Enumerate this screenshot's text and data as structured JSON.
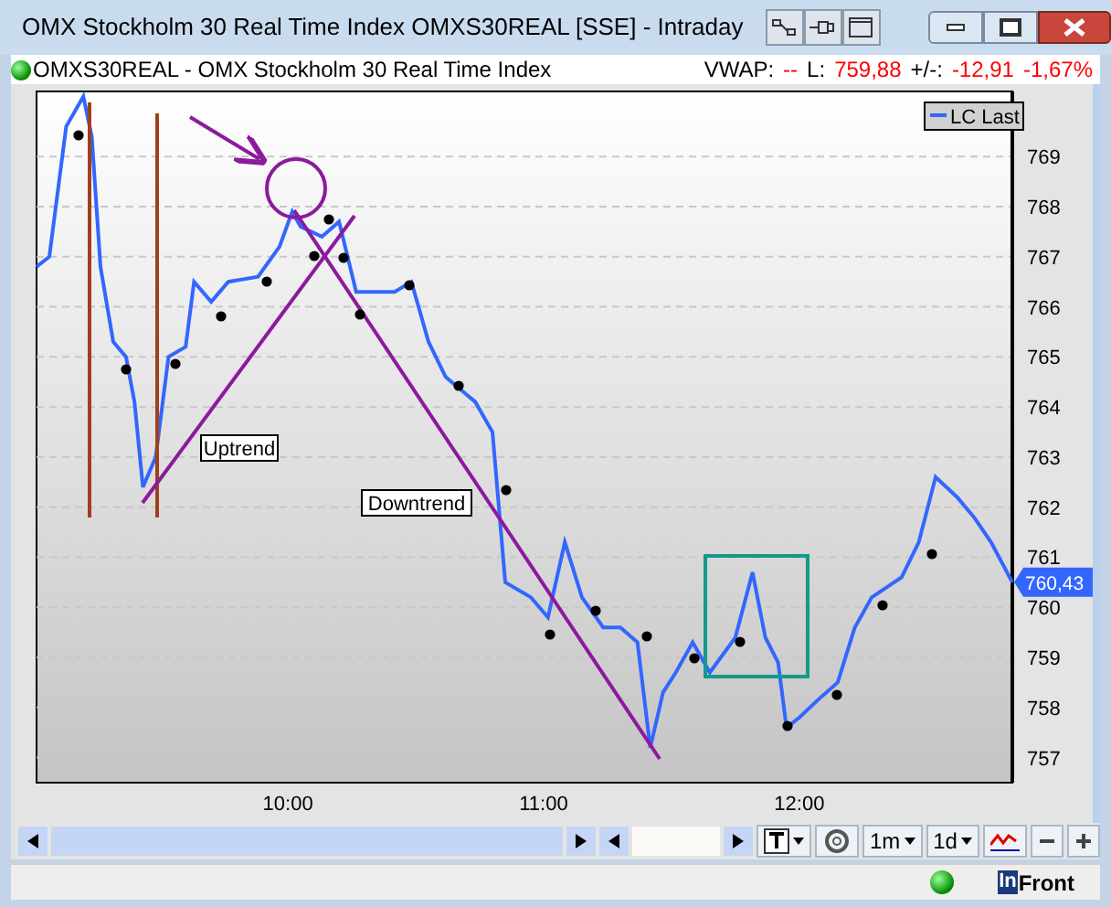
{
  "window": {
    "title": "OMX Stockholm 30 Real Time Index OMXS30REAL [SSE] - Intraday"
  },
  "info_bar": {
    "instrument": "OMXS30REAL - OMX Stockholm 30 Real Time Index",
    "quote_items": [
      {
        "label": "VWAP:",
        "values": [
          "--"
        ]
      },
      {
        "label": "L:",
        "values": [
          "759,88"
        ]
      },
      {
        "label": "+/-:",
        "values": [
          "-12,91",
          "-1,67%"
        ]
      }
    ]
  },
  "chart": {
    "last_price_label": "760,43",
    "chart_data": {
      "type": "line",
      "grid": true,
      "xlim": [
        9.017,
        12.833
      ],
      "ylim": [
        756.5,
        770.3
      ],
      "xticks": [
        {
          "value": 10,
          "label": "10:00"
        },
        {
          "value": 11,
          "label": "11:00"
        },
        {
          "value": 12,
          "label": "12:00"
        }
      ],
      "yticks": [
        757,
        758,
        759,
        760,
        761,
        762,
        763,
        764,
        765,
        766,
        767,
        768,
        769
      ],
      "x": [
        9.017,
        9.067,
        9.1,
        9.133,
        9.2,
        9.233,
        9.267,
        9.317,
        9.367,
        9.4,
        9.433,
        9.483,
        9.533,
        9.6,
        9.633,
        9.7,
        9.767,
        9.883,
        9.967,
        10.017,
        10.05,
        10.133,
        10.2,
        10.267,
        10.333,
        10.417,
        10.483,
        10.55,
        10.617,
        10.733,
        10.8,
        10.85,
        10.95,
        11.017,
        11.083,
        11.15,
        11.233,
        11.3,
        11.367,
        11.417,
        11.467,
        11.517,
        11.583,
        11.65,
        11.75,
        11.817,
        11.867,
        11.917,
        11.95,
        12,
        12.083,
        12.15,
        12.217,
        12.283,
        12.4,
        12.467,
        12.533,
        12.617,
        12.683,
        12.75,
        12.833
      ],
      "series": [
        {
          "name": "LC Last",
          "color": "#3366ff",
          "values": [
            766.8,
            767.0,
            768.3,
            769.6,
            770.2,
            769.4,
            766.8,
            765.3,
            765.0,
            764.1,
            762.4,
            763.0,
            765.0,
            765.2,
            766.5,
            766.1,
            766.5,
            766.6,
            767.2,
            767.9,
            767.6,
            767.4,
            767.7,
            766.3,
            766.3,
            766.3,
            766.5,
            765.3,
            764.6,
            764.1,
            763.5,
            760.5,
            760.2,
            759.8,
            761.3,
            760.2,
            759.6,
            759.6,
            759.3,
            757.2,
            758.3,
            758.7,
            759.3,
            758.7,
            759.4,
            760.7,
            759.4,
            758.9,
            757.6,
            757.8,
            758.2,
            758.5,
            759.6,
            760.2,
            760.6,
            761.3,
            762.6,
            762.2,
            761.8,
            761.3,
            760.5
          ]
        }
      ],
      "annotations": [
        {
          "text": "Uptrend"
        },
        {
          "text": "Downtrend"
        }
      ]
    }
  },
  "toolbar": {
    "interval": "1m",
    "period": "1d"
  },
  "status_bar": {
    "logo_mark": "In",
    "logo_text": "Front"
  }
}
